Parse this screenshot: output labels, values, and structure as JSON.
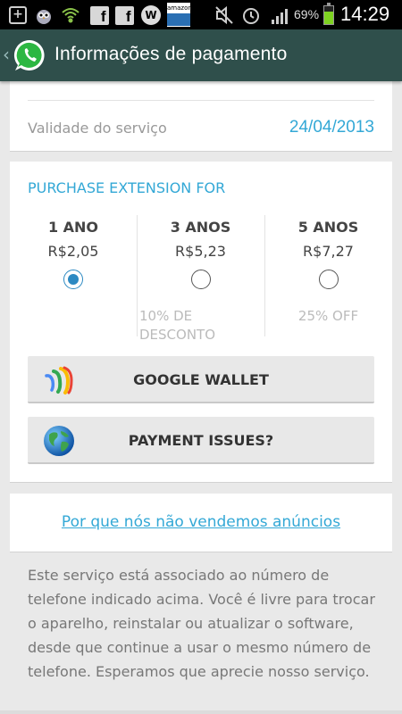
{
  "status_bar": {
    "icons": [
      "add-icon",
      "owl-icon",
      "wifi-icon",
      "facebook-icon",
      "facebook-icon",
      "w-icon",
      "amazon-icon",
      "mute-icon",
      "alarm-icon",
      "signal-icon"
    ],
    "fb_glyph": "f",
    "w_glyph": "W",
    "amazon_label": "amazon",
    "battery_percent": "69%",
    "battery_level": 0.69,
    "time": "14:29"
  },
  "action_bar": {
    "title": "Informações de pagamento"
  },
  "service": {
    "validity_label": "Validade do serviço",
    "validity_value": "24/04/2013"
  },
  "purchase": {
    "heading": "PURCHASE EXTENSION FOR",
    "plans": [
      {
        "name": "1 ANO",
        "price": "R$2,05",
        "selected": true,
        "discount": ""
      },
      {
        "name": "3 ANOS",
        "price": "R$5,23",
        "selected": false,
        "discount": "10% DE DESCONTO"
      },
      {
        "name": "5 ANOS",
        "price": "R$7,27",
        "selected": false,
        "discount": "25% OFF"
      }
    ],
    "wallet_button": "GOOGLE WALLET",
    "issues_button": "PAYMENT ISSUES?"
  },
  "ads_link": "Por que nós não vendemos anúncios",
  "info_text": "Este serviço está associado ao número de telefone indicado acima. Você é livre para trocar o aparelho, reinstalar ou atualizar o software, desde que continue a usar o mesmo número de telefone. Esperamos que aprecie nosso serviço.",
  "colors": {
    "action_bar": "#2f4f4b",
    "accent": "#33a8d6",
    "radio": "#2c89c2"
  }
}
